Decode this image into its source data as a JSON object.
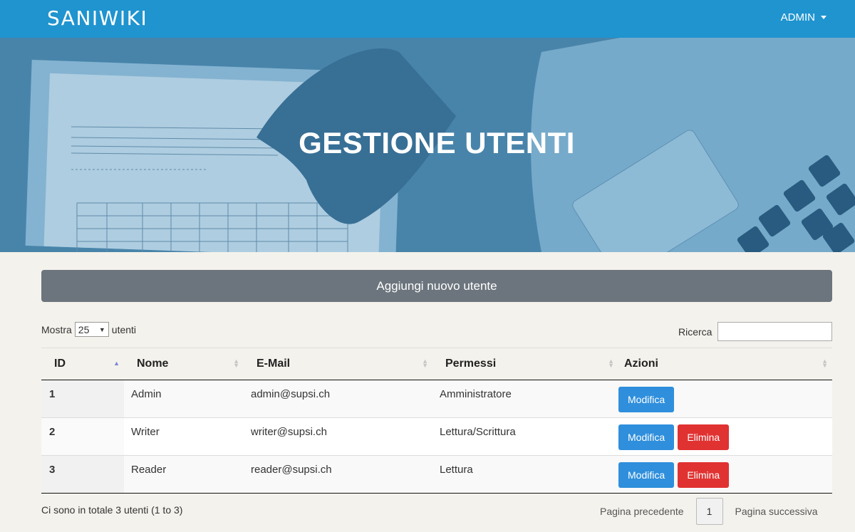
{
  "navbar": {
    "brand": "SANIWIKI",
    "user": "ADMIN"
  },
  "hero": {
    "title": "GESTIONE UTENTI"
  },
  "add_user_button": "Aggiungi nuovo utente",
  "length_menu": {
    "prefix": "Mostra",
    "value": "25",
    "suffix": "utenti"
  },
  "search": {
    "label": "Ricerca",
    "value": ""
  },
  "table": {
    "columns": [
      "ID",
      "Nome",
      "E-Mail",
      "Permessi",
      "Azioni"
    ],
    "rows": [
      {
        "id": "1",
        "name": "Admin",
        "email": "admin@supsi.ch",
        "permissions": "Amministratore",
        "edit": "Modifica"
      },
      {
        "id": "2",
        "name": "Writer",
        "email": "writer@supsi.ch",
        "permissions": "Lettura/Scrittura",
        "edit": "Modifica",
        "delete": "Elimina"
      },
      {
        "id": "3",
        "name": "Reader",
        "email": "reader@supsi.ch",
        "permissions": "Lettura",
        "edit": "Modifica",
        "delete": "Elimina"
      }
    ]
  },
  "footer": {
    "info": "Ci sono in totale 3 utenti (1 to 3)",
    "previous": "Pagina precedente",
    "page": "1",
    "next": "Pagina successiva"
  },
  "colors": {
    "navbar": "#1f94cf",
    "add_button": "#6c757d",
    "edit_button": "#2f8fdc",
    "delete_button": "#e13232"
  }
}
